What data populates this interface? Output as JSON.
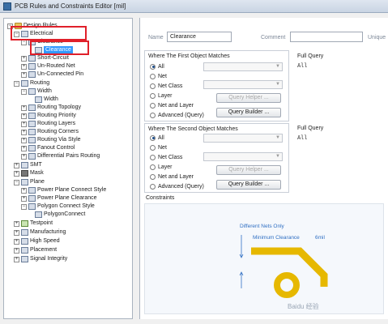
{
  "window": {
    "title": "PCB Rules and Constraints Editor [mil]"
  },
  "tree": {
    "items": [
      {
        "label": "Design Rules",
        "level": 0
      },
      {
        "label": "Electrical",
        "level": 1
      },
      {
        "label": "Clearance",
        "level": 2
      },
      {
        "label": "Clearance",
        "level": 3,
        "selected": true
      },
      {
        "label": "Short-Circuit",
        "level": 2
      },
      {
        "label": "Un-Routed Net",
        "level": 2
      },
      {
        "label": "Un-Connected Pin",
        "level": 2
      },
      {
        "label": "Routing",
        "level": 1
      },
      {
        "label": "Width",
        "level": 2
      },
      {
        "label": "Width",
        "level": 3
      },
      {
        "label": "Routing Topology",
        "level": 2
      },
      {
        "label": "Routing Priority",
        "level": 2
      },
      {
        "label": "Routing Layers",
        "level": 2
      },
      {
        "label": "Routing Corners",
        "level": 2
      },
      {
        "label": "Routing Via Style",
        "level": 2
      },
      {
        "label": "Fanout Control",
        "level": 2
      },
      {
        "label": "Differential Pairs Routing",
        "level": 2
      },
      {
        "label": "SMT",
        "level": 1
      },
      {
        "label": "Mask",
        "level": 1
      },
      {
        "label": "Plane",
        "level": 1
      },
      {
        "label": "Power Plane Connect Style",
        "level": 2
      },
      {
        "label": "Power Plane Clearance",
        "level": 2
      },
      {
        "label": "Polygon Connect Style",
        "level": 2
      },
      {
        "label": "PolygonConnect",
        "level": 3
      },
      {
        "label": "Testpoint",
        "level": 1
      },
      {
        "label": "Manufacturing",
        "level": 1
      },
      {
        "label": "High Speed",
        "level": 1
      },
      {
        "label": "Placement",
        "level": 1
      },
      {
        "label": "Signal Integrity",
        "level": 1
      }
    ]
  },
  "rule": {
    "name_label": "Name",
    "name_value": "Clearance",
    "comment_label": "Comment",
    "comment_value": "",
    "unique_label": "Unique"
  },
  "first_match": {
    "title": "Where The First Object Matches",
    "options": [
      "All",
      "Net",
      "Net Class",
      "Layer",
      "Net and Layer",
      "Advanced (Query)"
    ],
    "selected": "All",
    "query_helper": "Query Helper ...",
    "query_builder": "Query Builder ...",
    "full_query_label": "Full Query",
    "full_query": "All"
  },
  "second_match": {
    "title": "Where The Second Object Matches",
    "options": [
      "All",
      "Net",
      "Net Class",
      "Layer",
      "Net and Layer",
      "Advanced (Query)"
    ],
    "selected": "All",
    "query_helper": "Query Helper ...",
    "query_builder": "Query Builder ...",
    "full_query_label": "Full Query",
    "full_query": "All"
  },
  "constraints": {
    "title": "Constraints",
    "different_nets": "Different Nets Only",
    "min_clearance_label": "Minimum Clearance",
    "min_clearance_value": "6mil"
  },
  "watermark": "Baidu 经验",
  "colors": {
    "accent": "#3399ff",
    "highlight_box": "#e0202a",
    "trace": "#e6b800",
    "diagram_text": "#2f6fc3"
  }
}
